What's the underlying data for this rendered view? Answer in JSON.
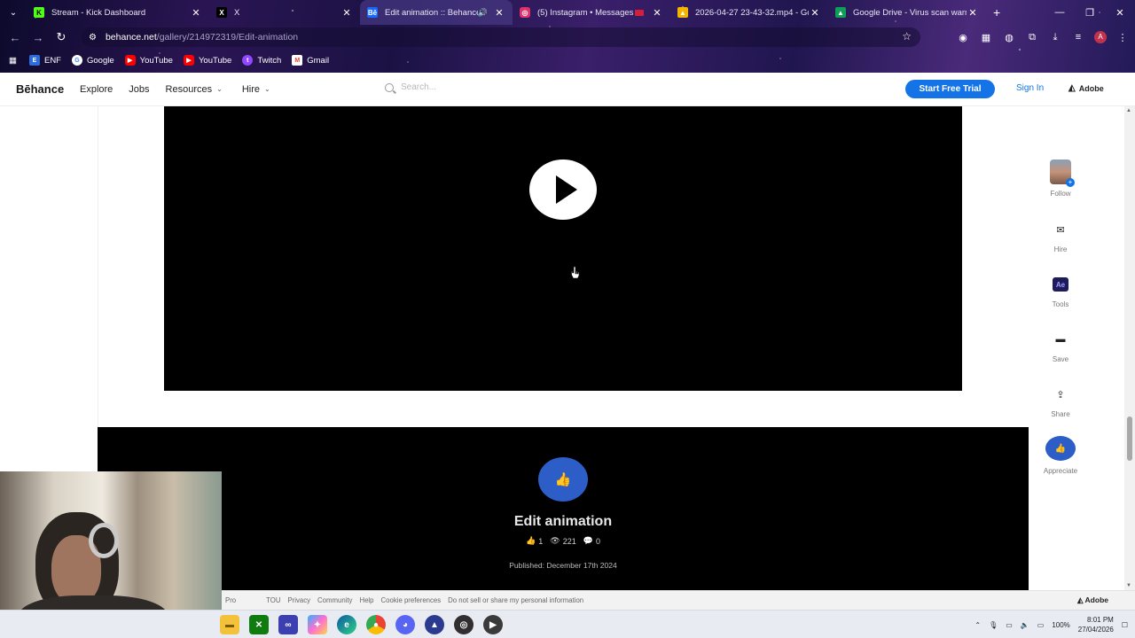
{
  "browser": {
    "tabs": [
      {
        "title": "Stream - Kick Dashboard",
        "icon": "kick-icon",
        "color": "#53fc18"
      },
      {
        "title": "X",
        "icon": "x-icon",
        "color": "#000000"
      },
      {
        "title": "Edit animation :: Behance",
        "icon": "behance-icon",
        "color": "#1769ff",
        "active": true
      },
      {
        "title": "(5) Instagram • Messages",
        "icon": "instagram-icon",
        "color": "#e1306c"
      },
      {
        "title": "2026-04-27 23-43-32.mp4 - Go",
        "icon": "google-drive-icon",
        "color": "#f4b400"
      },
      {
        "title": "Google Drive - Virus scan warn",
        "icon": "google-drive-icon",
        "color": "#0f9d58"
      }
    ],
    "url_domain": "behance.net",
    "url_path": "/gallery/214972319/Edit-animation",
    "profile_initial": "A",
    "bookmarks": [
      {
        "label": "ENF",
        "icon": "enf-icon",
        "color": "#2d6cdf"
      },
      {
        "label": "Google",
        "icon": "google-icon",
        "color": "#ffffff"
      },
      {
        "label": "YouTube",
        "icon": "youtube-icon",
        "color": "#ff0000"
      },
      {
        "label": "YouTube",
        "icon": "youtube-icon",
        "color": "#ff0000"
      },
      {
        "label": "Twitch",
        "icon": "twitch-icon",
        "color": "#9146ff"
      },
      {
        "label": "Gmail",
        "icon": "gmail-icon",
        "color": "#ea4335"
      }
    ]
  },
  "behance": {
    "logo": "Bēhance",
    "nav": [
      {
        "label": "Explore",
        "dropdown": false
      },
      {
        "label": "Jobs",
        "dropdown": false
      },
      {
        "label": "Resources",
        "dropdown": true
      },
      {
        "label": "Hire",
        "dropdown": true
      }
    ],
    "search_placeholder": "Search...",
    "start_trial": "Start Free Trial",
    "sign_in": "Sign In",
    "adobe": "Adobe",
    "accent": "#1473e6"
  },
  "project": {
    "title": "Edit animation",
    "appreciations": "1",
    "views": "221",
    "comments": "0",
    "published": "Published: December 17th 2024",
    "appreciate_color": "#2d5ec7"
  },
  "sidebar": {
    "follow": "Follow",
    "hire": "Hire",
    "tools": "Tools",
    "tools_badge": "Ae",
    "save": "Save",
    "share": "Share",
    "appreciate": "Appreciate"
  },
  "footer": {
    "links": [
      "Pro",
      "TOU",
      "Privacy",
      "Community",
      "Help",
      "Cookie preferences",
      "Do not sell or share my personal information"
    ],
    "adobe": "Adobe"
  },
  "taskbar": {
    "battery": "100%",
    "time": "8:01 PM",
    "date": "27/04/2026",
    "apps": [
      "file-explorer-icon",
      "xbox-icon",
      "visual-studio-icon",
      "copilot-icon",
      "edge-icon",
      "chrome-icon",
      "discord-icon",
      "app-icon",
      "obs-icon",
      "media-player-icon"
    ]
  }
}
